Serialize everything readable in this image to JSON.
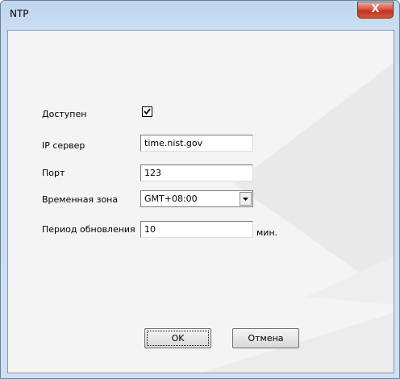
{
  "window": {
    "title": "NTP",
    "close_symbol": "X",
    "close_icon": "close-icon"
  },
  "form": {
    "enabled": {
      "label": "Доступен",
      "checked": true
    },
    "ip_server": {
      "label": "IP сервер",
      "value": "time.nist.gov"
    },
    "port": {
      "label": "Порт",
      "value": "123"
    },
    "timezone": {
      "label": "Временная зона",
      "value": "GMT+08:00"
    },
    "update_period": {
      "label": "Период обновления",
      "value": "10",
      "unit": "мин."
    }
  },
  "buttons": {
    "ok": "OK",
    "cancel": "Отмена"
  },
  "colors": {
    "frame": "#c9dcf0",
    "close_button": "#c8381f",
    "client": "#f4f4f4"
  }
}
